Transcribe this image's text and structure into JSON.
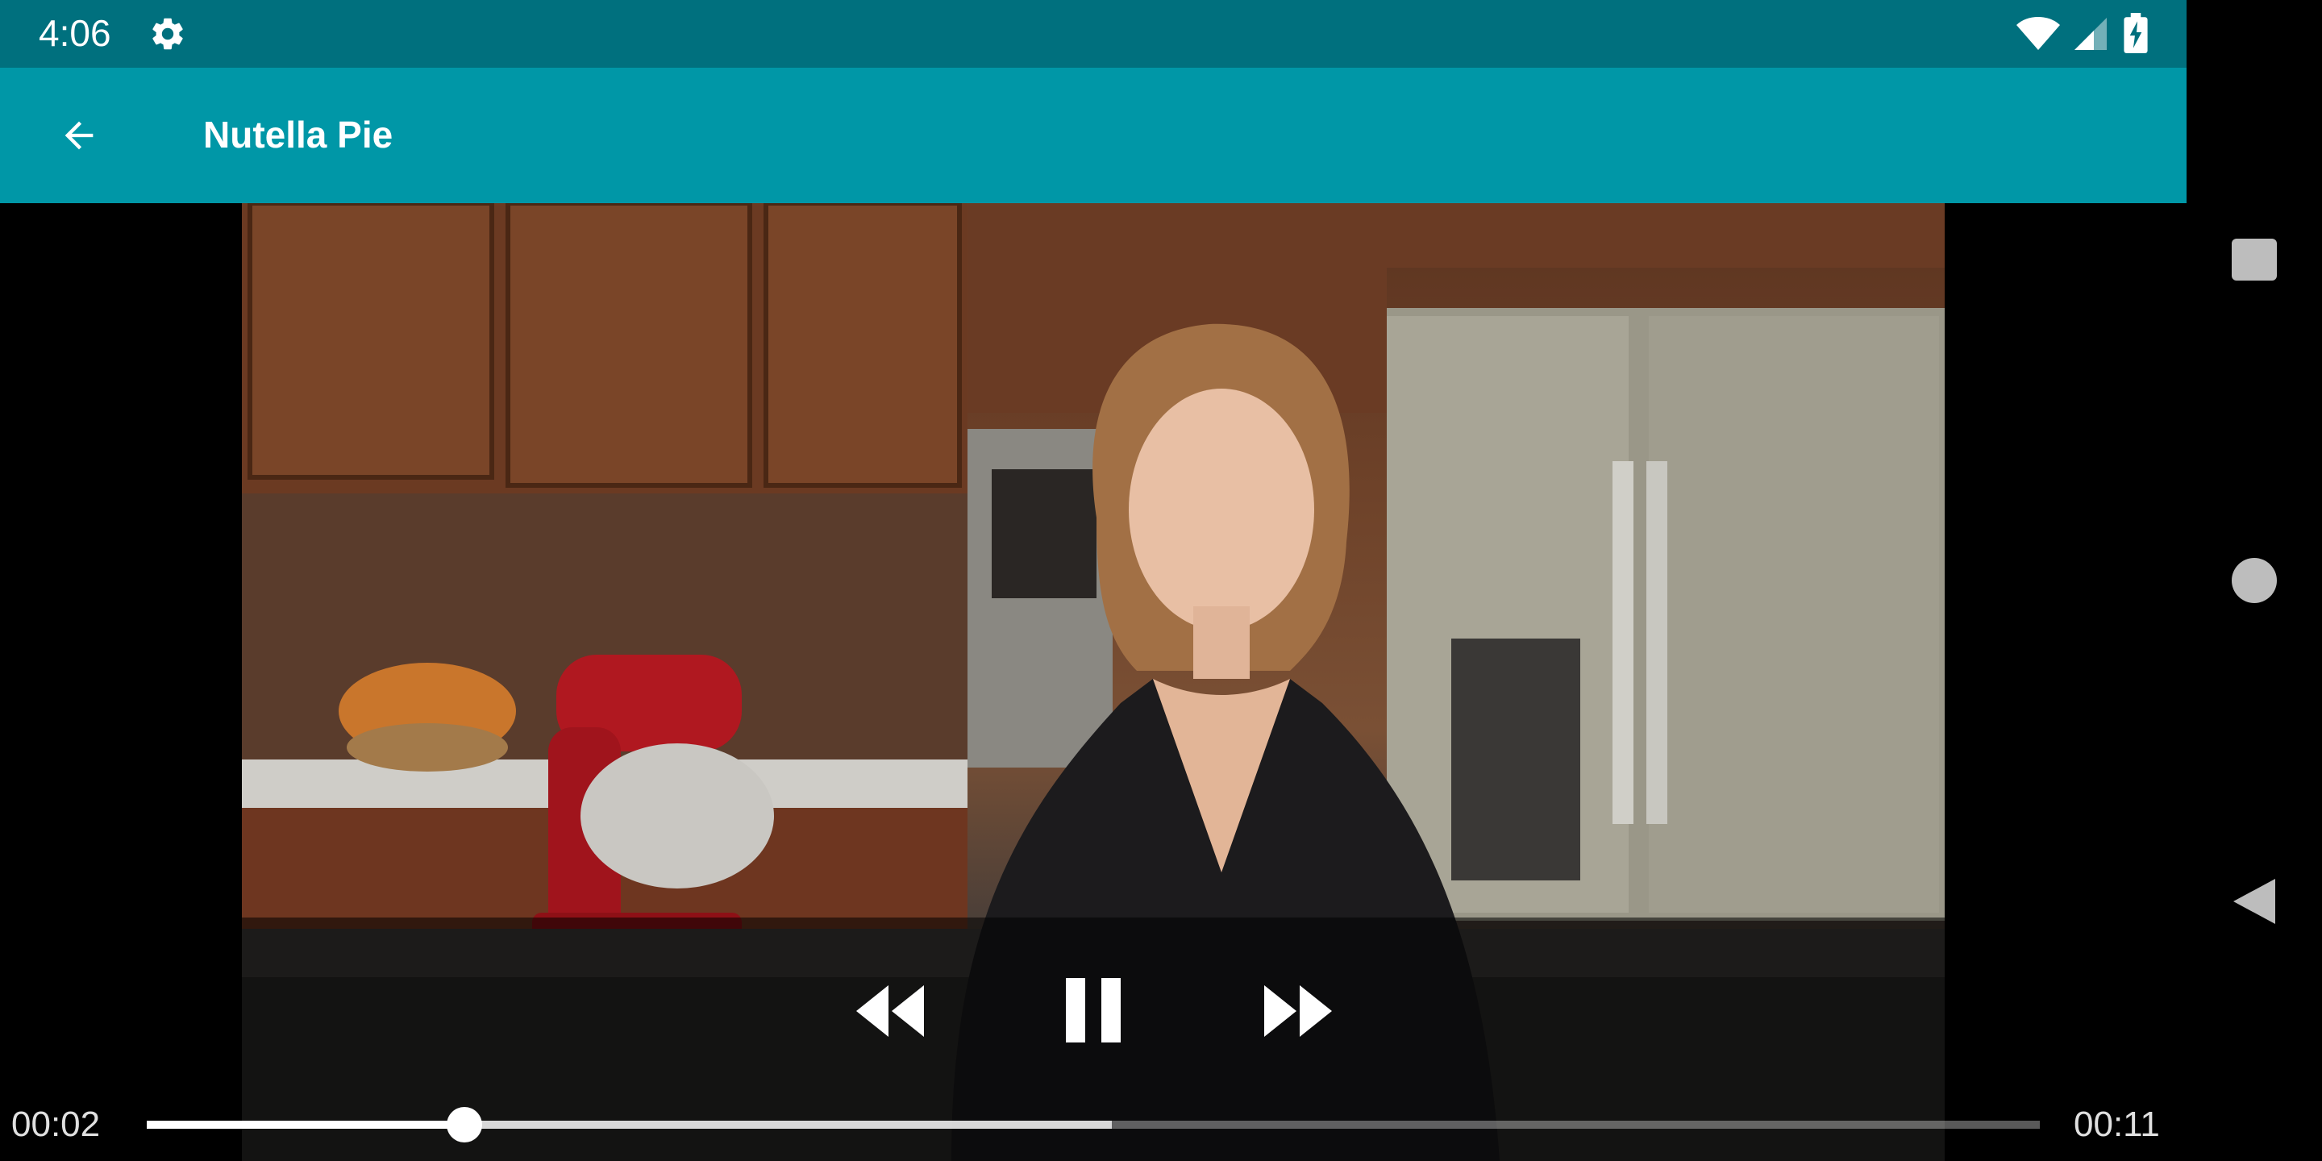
{
  "status_bar": {
    "time": "4:06",
    "icons": [
      "settings-icon",
      "wifi-icon",
      "signal-icon",
      "battery-charging-icon"
    ],
    "background_color": "#00707e"
  },
  "app_bar": {
    "title": "Nutella Pie",
    "back_icon": "arrow-back-icon",
    "background_color": "#0097a7"
  },
  "player": {
    "time_elapsed": "00:02",
    "time_total": "00:11",
    "played_fraction": 0.168,
    "buffered_fraction": 0.51,
    "controls": {
      "rewind_icon": "rewind-icon",
      "pause_icon": "pause-icon",
      "fast_forward_icon": "fast-forward-icon"
    }
  },
  "nav_bar": {
    "icons": [
      "recents-square-icon",
      "home-circle-icon",
      "back-triangle-icon"
    ]
  }
}
